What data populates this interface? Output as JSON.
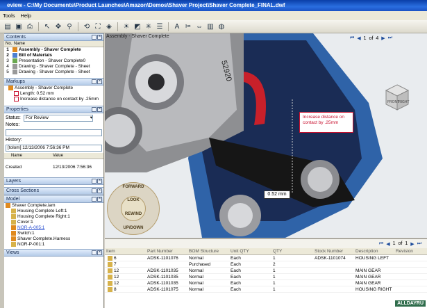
{
  "window": {
    "title": "eview - C:\\My Documents\\Product Launches\\Amazon\\Demos\\Shaver Project\\Shaver Complete_FINAL.dwf"
  },
  "menu": [
    "Tools",
    "Help"
  ],
  "panels": {
    "contents": {
      "title": "Contents",
      "col_no": "No.",
      "col_name": "Name",
      "items": [
        {
          "no": "1",
          "name": "Assembly - Shaver Complete"
        },
        {
          "no": "2",
          "name": "Bill of Materials"
        },
        {
          "no": "3",
          "name": "Presentation - Shaver Complete0"
        },
        {
          "no": "4",
          "name": "Drawing - Shaver Complete - Sheet"
        },
        {
          "no": "5",
          "name": "Drawing - Shaver Complete - Sheet"
        }
      ]
    },
    "markups": {
      "title": "Markups",
      "items": [
        "Assembly - Shaver Complete",
        "Length: 0.52 mm",
        "Increase distance on contact by .25mm"
      ]
    },
    "properties": {
      "title": "Properties",
      "status_label": "Status:",
      "status_value": "For Review",
      "notes_label": "Notes:",
      "history_label": "History:",
      "history_entry": "[tolom] 12/13/2006 7:56:36 PM",
      "col_name": "Name",
      "col_value": "Value",
      "created_label": "Created",
      "created_value": "12/13/2006 7:56:36"
    },
    "layers": {
      "title": "Layers"
    },
    "cross_sections": {
      "title": "Cross Sections"
    },
    "model": {
      "title": "Model",
      "items": [
        "Shaver Complete.iam",
        "Housing Complete Left:1",
        "Housing Complete Right:1",
        "Cover:1",
        "NOR-A-005:1",
        "Switch:1",
        "Shaver Complete.Harness",
        "NOR-P-001:1"
      ]
    },
    "views": {
      "title": "Views"
    }
  },
  "viewer": {
    "title": "Assembly - Shaver Complete",
    "page_current": "1",
    "page_of": "of",
    "page_total": "4",
    "callout": "Increase distance on contact by .25mm",
    "dimension": "0.52 mm",
    "part_label": "52920",
    "viewcube_front": "FRONT",
    "viewcube_right": "RIGHT",
    "nav_forward": "FORWARD",
    "nav_look": "LOOK",
    "nav_rewind": "REWIND",
    "nav_updown": "UP/DOWN"
  },
  "bom": {
    "page_current": "1",
    "page_of": "of",
    "page_total": "1",
    "headers": [
      "Item",
      "Part Number",
      "BOM Structure",
      "Unit QTY",
      "QTY",
      "Stock Number",
      "Description",
      "Revision"
    ],
    "rows": [
      [
        "6",
        "ADSK-1101076",
        "Normal",
        "Each",
        "1",
        "ADSK-1101074",
        "HOUSING LEFT",
        ""
      ],
      [
        "7",
        "",
        "Purchased",
        "Each",
        "2",
        "",
        "",
        ""
      ],
      [
        "12",
        "ADSK-1101035",
        "Normal",
        "Each",
        "1",
        "",
        "MAIN GEAR",
        ""
      ],
      [
        "12",
        "ADSK-1101035",
        "Normal",
        "Each",
        "1",
        "",
        "MAIN GEAR",
        ""
      ],
      [
        "12",
        "ADSK-1101035",
        "Normal",
        "Each",
        "1",
        "",
        "MAIN GEAR",
        ""
      ],
      [
        "8",
        "ADSK-1101075",
        "Normal",
        "Each",
        "1",
        "",
        "HOUSING RIGHT",
        ""
      ]
    ]
  },
  "watermark": "ALLDAYRU"
}
